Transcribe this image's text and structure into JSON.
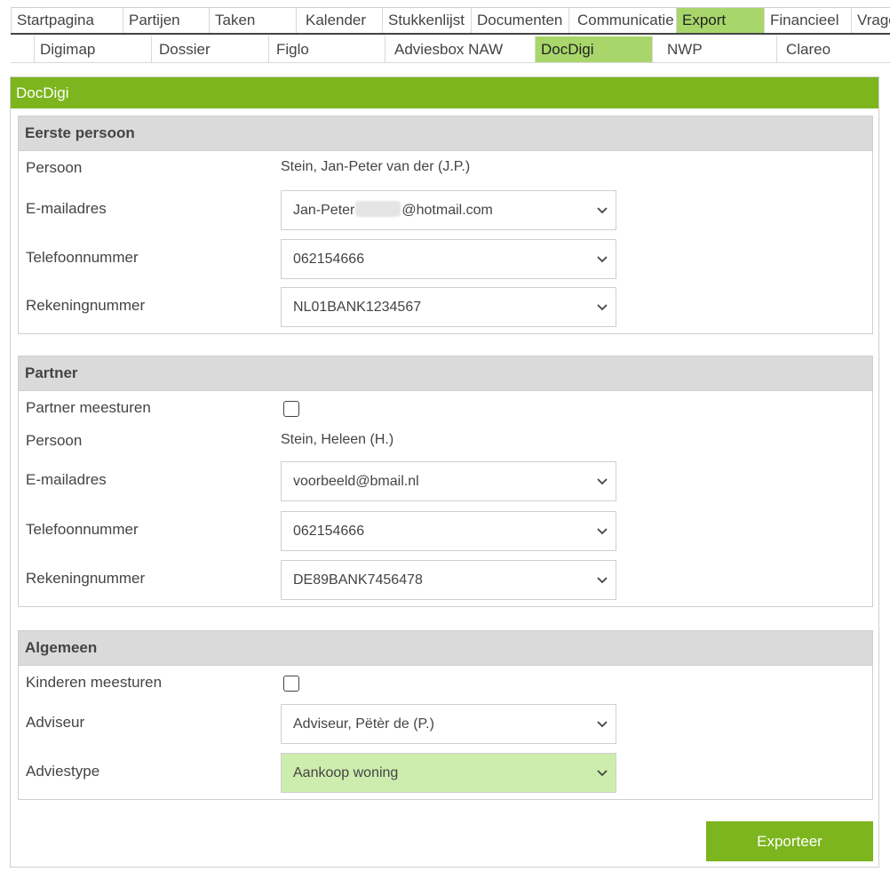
{
  "nav": {
    "primary": [
      {
        "label": "Startpagina",
        "active": false
      },
      {
        "label": "Partijen",
        "active": false
      },
      {
        "label": "Taken",
        "active": false
      },
      {
        "label": "Kalender",
        "active": false
      },
      {
        "label": "Stukkenlijst",
        "active": false
      },
      {
        "label": "Documenten",
        "active": false
      },
      {
        "label": "Communicatie",
        "active": false
      },
      {
        "label": "Export",
        "active": true
      },
      {
        "label": "Financieel",
        "active": false
      },
      {
        "label": "Vragen",
        "active": false
      }
    ],
    "secondary": [
      {
        "label": "Digimap",
        "active": false
      },
      {
        "label": "Dossier",
        "active": false
      },
      {
        "label": "Figlo",
        "active": false
      },
      {
        "label": "Adviesbox NAW",
        "active": false
      },
      {
        "label": "DocDigi",
        "active": true
      },
      {
        "label": "NWP",
        "active": false
      },
      {
        "label": "Clareo",
        "active": false
      }
    ]
  },
  "panel": {
    "title": "DocDigi"
  },
  "first_person": {
    "title": "Eerste persoon",
    "person_label": "Persoon",
    "person_value": "Stein, Jan-Peter van der (J.P.)",
    "email_label": "E-mailadres",
    "email_prefix": "Jan-Peter",
    "email_suffix": "@hotmail.com",
    "phone_label": "Telefoonnummer",
    "phone_value": "062154666",
    "account_label": "Rekeningnummer",
    "account_value": "NL01BANK1234567"
  },
  "partner": {
    "title": "Partner",
    "send_label": "Partner meesturen",
    "send_checked": false,
    "person_label": "Persoon",
    "person_value": "Stein, Heleen (H.)",
    "email_label": "E-mailadres",
    "email_value": "voorbeeld@bmail.nl",
    "phone_label": "Telefoonnummer",
    "phone_value": "062154666",
    "account_label": "Rekeningnummer",
    "account_value": "DE89BANK7456478"
  },
  "general": {
    "title": "Algemeen",
    "children_label": "Kinderen meesturen",
    "children_checked": false,
    "advisor_label": "Adviseur",
    "advisor_value": "Adviseur, Pëtèr de (P.)",
    "advice_type_label": "Adviestype",
    "advice_type_value": "Aankoop woning"
  },
  "actions": {
    "export_label": "Exporteer"
  },
  "colors": {
    "accent": "#7cb51d",
    "active_tab": "#a8d66a",
    "highlight_select": "#cdedae",
    "section_header": "#dadada"
  }
}
